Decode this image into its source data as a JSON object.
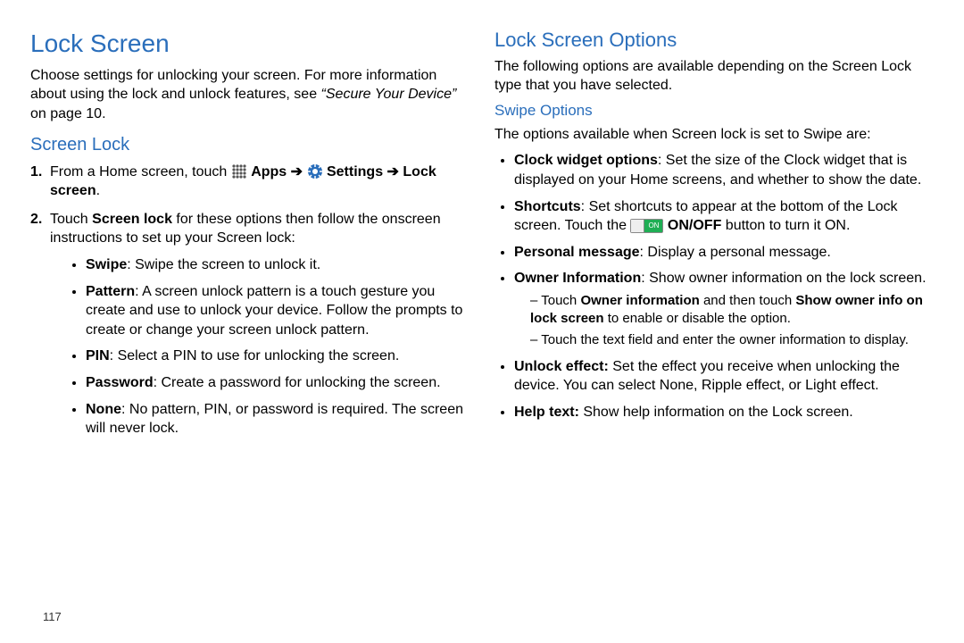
{
  "page_number": "117",
  "left": {
    "h1": "Lock Screen",
    "intro_pre": "Choose settings for unlocking your screen. For more information about using the lock and unlock features, see ",
    "intro_ref": "“Secure Your Device”",
    "intro_post": " on page 10.",
    "h2": "Screen Lock",
    "step1": {
      "num": "1.",
      "pre": "From a Home screen, touch ",
      "apps": "Apps",
      "arrow1": " ➔ ",
      "settings": "Settings",
      "arrow2": " ➔ ",
      "lockscreen": "Lock screen",
      "end": "."
    },
    "step2": {
      "num": "2.",
      "pre": "Touch ",
      "screen_lock": "Screen lock",
      "post": " for these options then follow the onscreen instructions to set up your Screen lock:"
    },
    "opts": {
      "swipe": {
        "b": "Swipe",
        "t": ": Swipe the screen to unlock it."
      },
      "pattern": {
        "b": "Pattern",
        "t": ": A screen unlock pattern is a touch gesture you create and use to unlock your device. Follow the prompts to create or change your screen unlock pattern."
      },
      "pin": {
        "b": "PIN",
        "t": ": Select a PIN to use for unlocking the screen."
      },
      "password": {
        "b": "Password",
        "t": ": Create a password for unlocking the screen."
      },
      "none": {
        "b": "None",
        "t": ": No pattern, PIN, or password is required. The screen will never lock."
      }
    }
  },
  "right": {
    "h2": "Lock Screen Options",
    "intro": "The following options are available depending on the Screen Lock type that you have selected.",
    "h3": "Swipe Options",
    "lead": "The options available when Screen lock is set to Swipe are:",
    "items": {
      "clock": {
        "b": "Clock widget options",
        "t": ": Set the size of the Clock widget that is displayed on your Home screens, and whether to show the date."
      },
      "shortcuts": {
        "b": "Shortcuts",
        "t1": ": Set shortcuts to appear at the bottom of the Lock screen. Touch the ",
        "onoff_label": "ON",
        "onoff_bold": "ON/OFF",
        "t2": " button to turn it ON."
      },
      "personal": {
        "b": "Personal message",
        "t": ": Display a personal message."
      },
      "owner": {
        "b": "Owner Information",
        "t": ": Show owner information on the lock screen.",
        "sub1_pre": "Touch ",
        "sub1_b1": "Owner information",
        "sub1_mid": " and then touch ",
        "sub1_b2": "Show owner info on lock screen",
        "sub1_post": " to enable or disable the option.",
        "sub2": "Touch the text field and enter the owner information to display."
      },
      "unlock": {
        "b": "Unlock effect:",
        "t": " Set the effect you receive when unlocking the device. You can select None, Ripple effect, or Light effect."
      },
      "help": {
        "b": "Help text:",
        "t": " Show help information on the Lock screen."
      }
    }
  }
}
